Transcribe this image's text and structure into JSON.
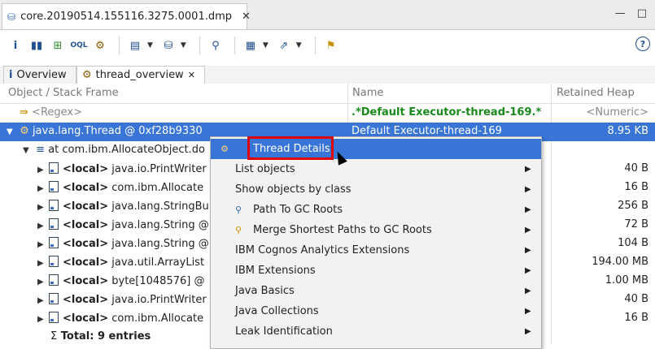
{
  "editor_tab": {
    "title": "core.20190514.155116.3275.0001.dmp"
  },
  "window_buttons": [
    "—",
    "□"
  ],
  "toolbar": {
    "icons": [
      "info-icon",
      "histogram-icon",
      "dominator-tree-icon",
      "oql-icon",
      "threads-icon",
      "query-browser-icon",
      "heap-dump-overview-icon",
      "search-icon",
      "table-icon",
      "export-icon",
      "pin-icon"
    ]
  },
  "help": {
    "label": "?"
  },
  "inner_tabs": [
    {
      "icon": "i",
      "label": "Overview"
    },
    {
      "icon": "⚙",
      "label": "thread_overview"
    }
  ],
  "table": {
    "headers": [
      "Object / Stack Frame",
      "Name",
      "Retained Heap"
    ],
    "regex_row": {
      "c1": "<Regex>",
      "c2": ".*Default Executor-thread-169.*",
      "c3": "<Numeric>"
    },
    "thread_row": {
      "c1": "java.lang.Thread @ 0xf28b9330",
      "c2": "Default Executor-thread-169",
      "c3": "8.95 KB"
    },
    "frame_row": {
      "c1": "at com.ibm.AllocateObject.do"
    },
    "locals": [
      {
        "tag": "<local>",
        "c1": "java.io.PrintWriter",
        "c3": "40 B"
      },
      {
        "tag": "<local>",
        "c1": "com.ibm.Allocate",
        "c3": "16 B"
      },
      {
        "tag": "<local>",
        "c1": "java.lang.StringBu",
        "c3": "256 B"
      },
      {
        "tag": "<local>",
        "c1": "java.lang.String @",
        "c3": "72 B"
      },
      {
        "tag": "<local>",
        "c1": "java.lang.String @",
        "c3": "104 B"
      },
      {
        "tag": "<local>",
        "c1": "java.util.ArrayList",
        "c3": "194.00 MB"
      },
      {
        "tag": "<local>",
        "c1": "byte[1048576] @",
        "c3": "1.00 MB"
      },
      {
        "tag": "<local>",
        "c1": "java.io.PrintWriter",
        "c3": "40 B"
      },
      {
        "tag": "<local>",
        "c1": "com.ibm.Allocate",
        "c3": "16 B"
      }
    ],
    "total_row": {
      "c1": "Total: 9 entries"
    }
  },
  "context_menu": {
    "items": [
      {
        "label": "Thread Details",
        "icon": "⚙",
        "submenu": false,
        "highlighted": true
      },
      {
        "label": "List objects",
        "icon": "",
        "submenu": true
      },
      {
        "label": "Show objects by class",
        "icon": "",
        "submenu": true
      },
      {
        "label": "Path To GC Roots",
        "icon": "⚲",
        "submenu": true
      },
      {
        "label": "Merge Shortest Paths to GC Roots",
        "icon": "⚲",
        "submenu": true
      },
      {
        "label": "IBM Cognos Analytics Extensions",
        "icon": "",
        "submenu": true
      },
      {
        "label": "IBM Extensions",
        "icon": "",
        "submenu": true
      },
      {
        "label": "Java Basics",
        "icon": "",
        "submenu": true
      },
      {
        "label": "Java Collections",
        "icon": "",
        "submenu": true
      },
      {
        "label": "Leak Identification",
        "icon": "",
        "submenu": true
      }
    ]
  },
  "colors": {
    "selection": "#3875d7",
    "highlight_border": "#e00000",
    "regex_text": "#1a8a1a"
  }
}
